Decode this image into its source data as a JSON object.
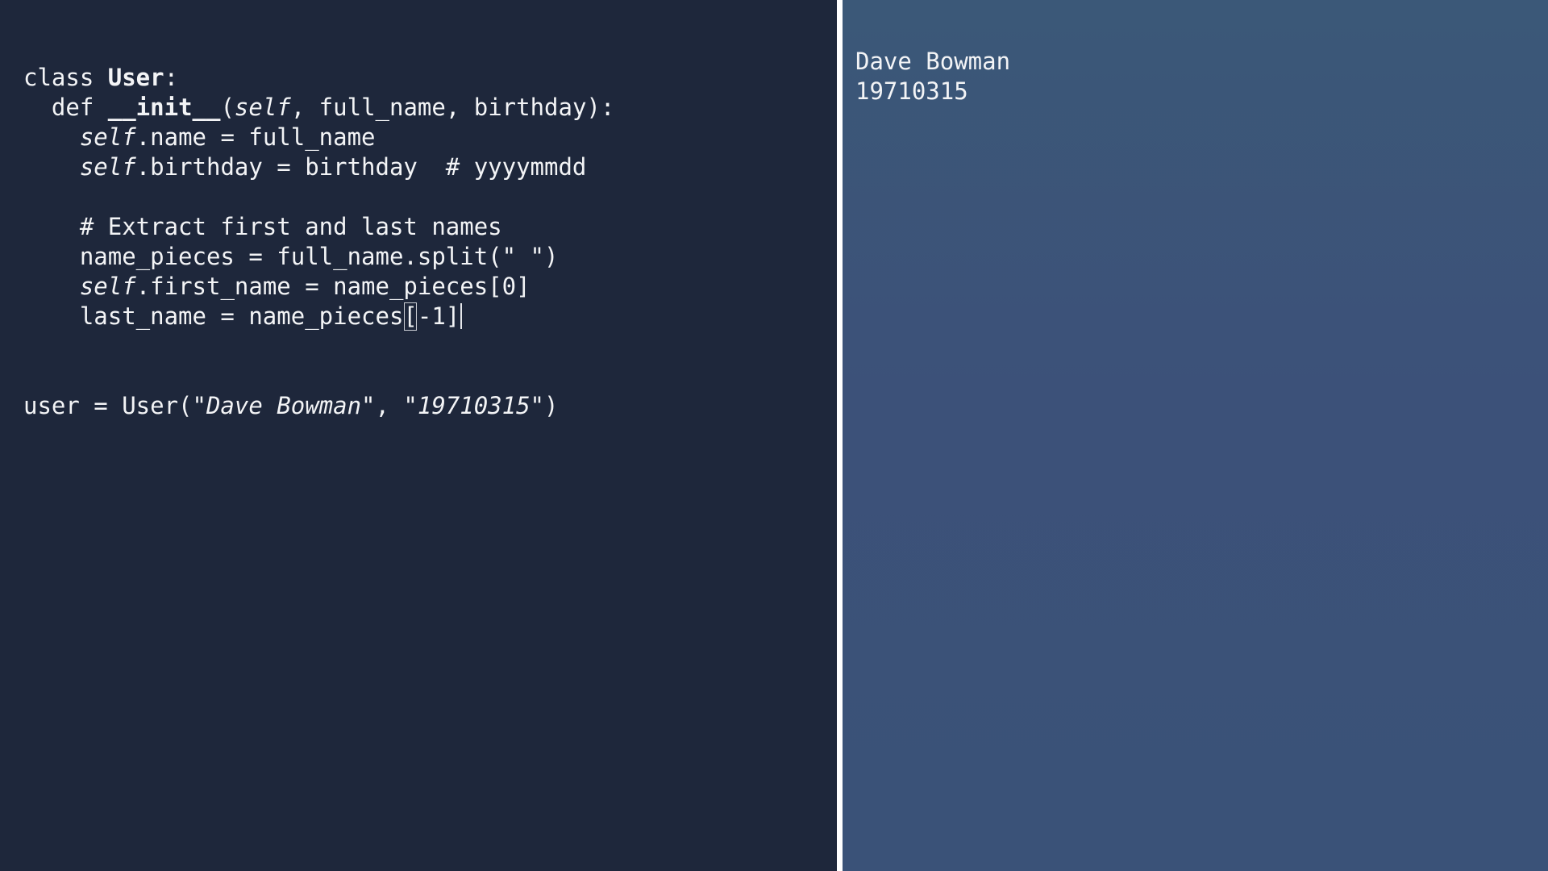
{
  "editor": {
    "lines": {
      "l1": {
        "a": "class ",
        "b": "User",
        "c": ":"
      },
      "l2": {
        "a": "  def ",
        "b": "__init__",
        "c": "(",
        "d": "self",
        "e": ", full_name, birthday):"
      },
      "l3": {
        "a": "    ",
        "b": "self",
        "c": ".name = full_name"
      },
      "l4": {
        "a": "    ",
        "b": "self",
        "c": ".birthday = birthday  # yyyymmdd"
      },
      "l5": {
        "a": "    # Extract first and last names"
      },
      "l6": {
        "a": "    name_pieces = full_name.split(\" \")"
      },
      "l7": {
        "a": "    ",
        "b": "self",
        "c": ".first_name = name_pieces[0]"
      },
      "l8": {
        "a": "    last_name = name_pieces",
        "b": "[",
        "c": "-1]"
      },
      "l9": {
        "a": "user = User(",
        "b": "\"Dave Bowman\"",
        "c": ", ",
        "d": "\"19710315\"",
        "e": ")"
      }
    }
  },
  "output": {
    "lines": [
      "Dave Bowman",
      "19710315"
    ]
  },
  "colors": {
    "editor_bg": "#1e273b",
    "output_bg": "#3b5379",
    "divider": "#ffffff",
    "text": "#f3f4f6"
  }
}
